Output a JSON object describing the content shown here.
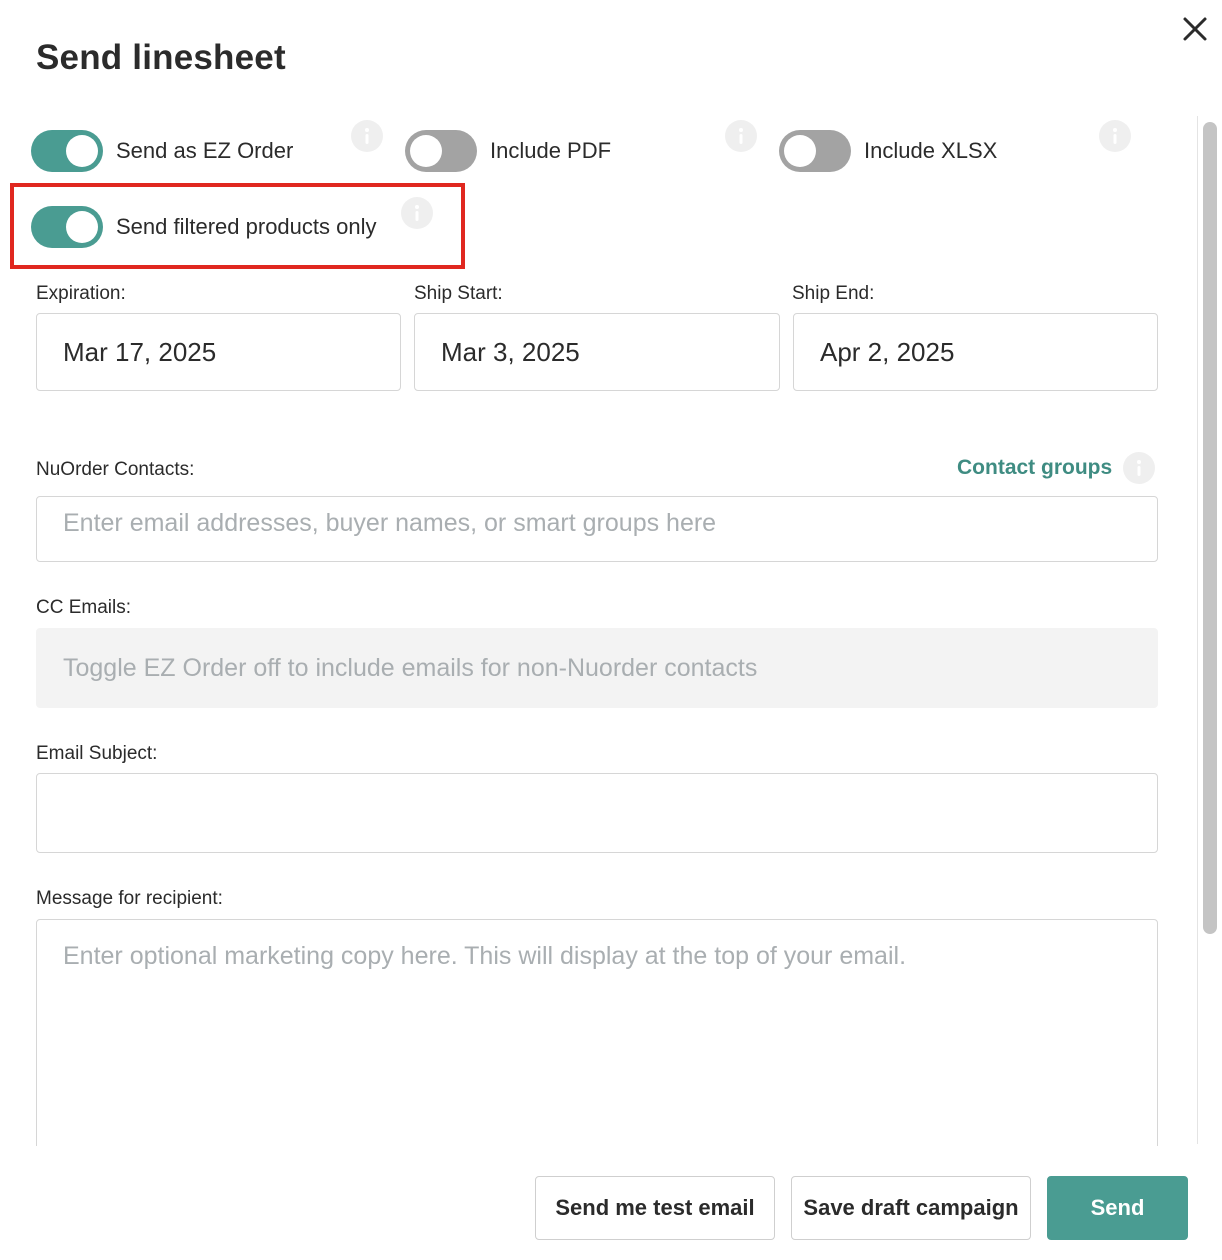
{
  "dialog": {
    "title": "Send linesheet"
  },
  "toggles": {
    "ez_order": {
      "label": "Send as EZ Order",
      "on": true
    },
    "include_pdf": {
      "label": "Include PDF",
      "on": false
    },
    "include_xlsx": {
      "label": "Include XLSX",
      "on": false
    },
    "filtered_products": {
      "label": "Send filtered products only",
      "on": true
    }
  },
  "dates": {
    "expiration": {
      "label": "Expiration:",
      "value": "Mar 17, 2025"
    },
    "ship_start": {
      "label": "Ship Start:",
      "value": "Mar 3, 2025"
    },
    "ship_end": {
      "label": "Ship End:",
      "value": "Apr 2, 2025"
    }
  },
  "contacts": {
    "label": "NuOrder Contacts:",
    "groups_link": "Contact groups",
    "placeholder": "Enter email addresses, buyer names, or smart groups here"
  },
  "cc": {
    "label": "CC Emails:",
    "placeholder": "Toggle EZ Order off to include emails for non-Nuorder contacts"
  },
  "subject": {
    "label": "Email Subject:",
    "value": ""
  },
  "message": {
    "label": "Message for recipient:",
    "placeholder": "Enter optional marketing copy here. This will display at the top of your email."
  },
  "footer": {
    "test_email": "Send me test email",
    "save_draft": "Save draft campaign",
    "send": "Send"
  },
  "colors": {
    "accent": "#4a9c92",
    "link": "#3f8c82",
    "highlight": "#e0271f",
    "toggle_off": "#a3a3a3"
  },
  "icons": {
    "close": "close-icon",
    "info": "info-icon"
  }
}
